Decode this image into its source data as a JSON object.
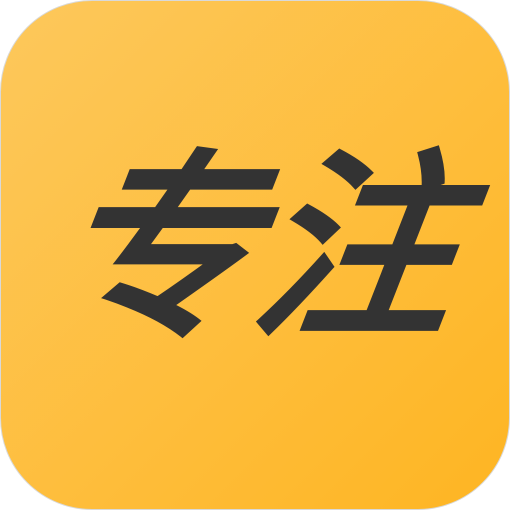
{
  "icon": {
    "name": "app-icon",
    "label": "专注",
    "text_color": "#333333",
    "background_top": "#fdc85c",
    "background_bottom": "#feb522",
    "border_color": "#d9d9d9"
  }
}
